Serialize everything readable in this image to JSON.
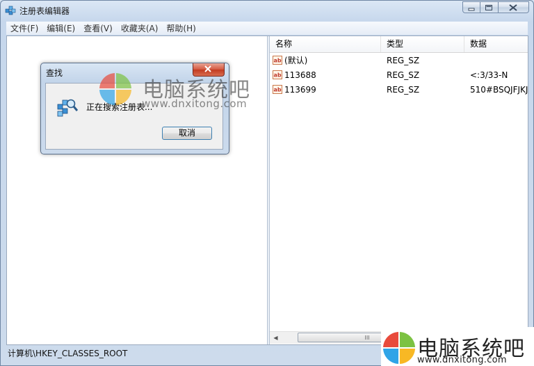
{
  "window": {
    "title": "注册表编辑器"
  },
  "menu": [
    "文件(F)",
    "编辑(E)",
    "查看(V)",
    "收藏夹(A)",
    "帮助(H)"
  ],
  "list": {
    "columns": [
      "名称",
      "类型",
      "数据"
    ],
    "rows": [
      {
        "name": "(默认)",
        "type": "REG_SZ",
        "data": ""
      },
      {
        "name": "113688",
        "type": "REG_SZ",
        "data": "<:3/33-N"
      },
      {
        "name": "113699",
        "type": "REG_SZ",
        "data": "510#BSQJFJKJ"
      }
    ],
    "scroll_grip": "III"
  },
  "status": {
    "path": "计算机\\HKEY_CLASSES_ROOT"
  },
  "dialog": {
    "title": "查找",
    "message": "正在搜索注册表...",
    "cancel_label": "取消"
  },
  "watermark": {
    "brand": "电脑系统吧",
    "url": "www.dnxitong.com"
  },
  "colors": {
    "logo_red": "#e84b3c",
    "logo_green": "#7cc242",
    "logo_blue": "#2fa4e7",
    "logo_yellow": "#f8b824",
    "focus_blue": "#3c7fb1"
  }
}
